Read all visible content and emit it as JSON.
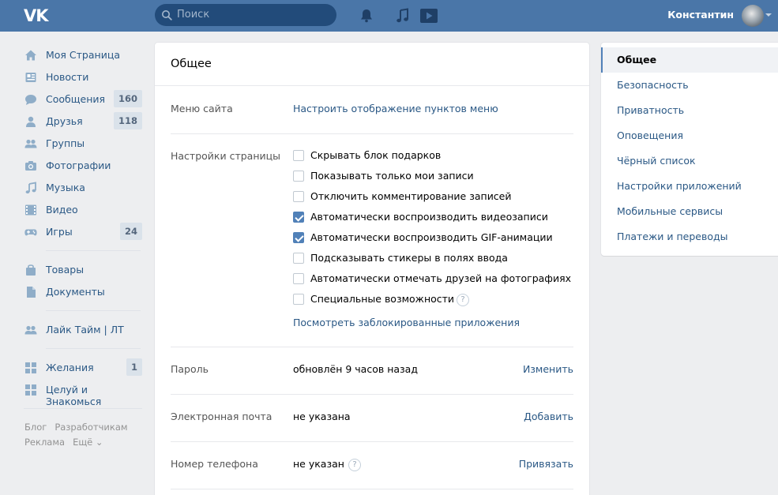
{
  "header": {
    "logo": "VK",
    "search_placeholder": "Поиск",
    "user_name": "Константин"
  },
  "sidebar": {
    "items": [
      {
        "label": "Моя Страница",
        "count": null,
        "icon": "home-icon"
      },
      {
        "label": "Новости",
        "count": null,
        "icon": "news-icon"
      },
      {
        "label": "Сообщения",
        "count": "160",
        "icon": "messages-icon"
      },
      {
        "label": "Друзья",
        "count": "118",
        "icon": "friends-icon"
      },
      {
        "label": "Группы",
        "count": null,
        "icon": "groups-icon"
      },
      {
        "label": "Фотографии",
        "count": null,
        "icon": "camera-icon"
      },
      {
        "label": "Музыка",
        "count": null,
        "icon": "music-icon"
      },
      {
        "label": "Видео",
        "count": null,
        "icon": "video-icon"
      },
      {
        "label": "Игры",
        "count": "24",
        "icon": "gamepad-icon"
      },
      {
        "label": "Товары",
        "count": null,
        "icon": "bag-icon"
      },
      {
        "label": "Документы",
        "count": null,
        "icon": "document-icon"
      },
      {
        "label": "Лайк Тайм | ЛТ",
        "count": null,
        "icon": "groups-icon"
      },
      {
        "label": "Желания",
        "count": "1",
        "icon": "apps-icon"
      },
      {
        "label": "Целуй и Знакомься",
        "count": null,
        "icon": "apps-icon"
      }
    ],
    "footer": [
      "Блог",
      "Разработчикам",
      "Реклама",
      "Ещё ⌄"
    ]
  },
  "main": {
    "title": "Общее",
    "menu_label": "Меню сайта",
    "menu_link": "Настроить отображение пунктов меню",
    "page_settings_label": "Настройки страницы",
    "checkboxes": [
      {
        "label": "Скрывать блок подарков",
        "checked": false
      },
      {
        "label": "Показывать только мои записи",
        "checked": false
      },
      {
        "label": "Отключить комментирование записей",
        "checked": false
      },
      {
        "label": "Автоматически воспроизводить видеозаписи",
        "checked": true
      },
      {
        "label": "Автоматически воспроизводить GIF-анимации",
        "checked": true
      },
      {
        "label": "Подсказывать стикеры в полях ввода",
        "checked": false
      },
      {
        "label": "Автоматически отмечать друзей на фотографиях",
        "checked": false
      },
      {
        "label": "Специальные возможности",
        "checked": false
      }
    ],
    "blocked_apps_link": "Посмотреть заблокированные приложения",
    "password": {
      "label": "Пароль",
      "value": "обновлён 9 часов назад",
      "action": "Изменить"
    },
    "email": {
      "label": "Электронная почта",
      "value": "не указана",
      "action": "Добавить"
    },
    "phone": {
      "label": "Номер телефона",
      "value": "не указан",
      "action": "Привязать"
    },
    "help_glyph": "?"
  },
  "right_menu": {
    "items": [
      "Общее",
      "Безопасность",
      "Приватность",
      "Оповещения",
      "Чёрный список",
      "Настройки приложений",
      "Мобильные сервисы",
      "Платежи и переводы"
    ],
    "active_index": 0
  },
  "colors": {
    "header_bg": "#4a76a8",
    "link": "#2a5885",
    "checkbox_on": "#5181b8",
    "page_bg": "#edeef0"
  }
}
